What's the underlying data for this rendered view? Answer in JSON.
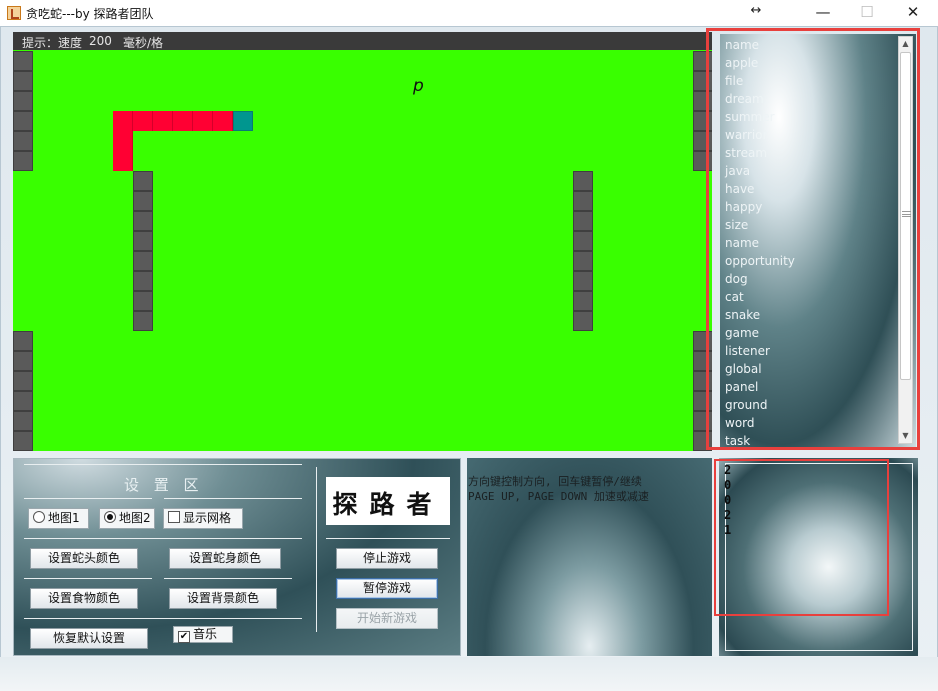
{
  "window": {
    "title": "贪吃蛇---by 探路者团队",
    "icon": "java-cup-icon",
    "resize_glyph": "↔",
    "minimize_glyph": "—",
    "maximize_glyph": "☐",
    "close_glyph": "✕"
  },
  "board": {
    "background": "#39ff00",
    "hint_label": "提示：速度",
    "hint_speed": "200",
    "hint_unit": "毫秒/格",
    "food_char": "p",
    "wall_color": "#5a5a5a",
    "snake_color": "#ff0033",
    "snake_head_color": "#00968f"
  },
  "word_list": [
    "name",
    "apple",
    "file",
    "dream",
    "summer",
    "warrior",
    "stream",
    "java",
    "have",
    "happy",
    "size",
    "name",
    "opportunity",
    "dog",
    "cat",
    "snake",
    "game",
    "listener",
    "global",
    "panel",
    "ground",
    "word",
    "task"
  ],
  "settings": {
    "title": "设 置 区",
    "map1": "地图1",
    "map2": "地图2",
    "map_selected": "map2",
    "show_grid": "显示网格",
    "show_grid_checked": false,
    "snake_head_color_btn": "设置蛇头颜色",
    "snake_body_color_btn": "设置蛇身颜色",
    "food_color_btn": "设置食物颜色",
    "background_color_btn": "设置背景颜色",
    "restore_defaults_btn": "恢复默认设置",
    "music": "音乐",
    "music_checked": true,
    "check_glyph": "✔",
    "logo_text": "探路者",
    "stop_btn": "停止游戏",
    "pause_btn": "暂停游戏",
    "new_game_btn": "开始新游戏"
  },
  "instructions": {
    "line1": "方向键控制方向, 回车键暂停/继续",
    "line2": "PAGE UP, PAGE DOWN 加速或减速"
  },
  "digits": [
    "2",
    "0",
    "0",
    "2",
    "1"
  ],
  "highlight_color": "#e8403d"
}
